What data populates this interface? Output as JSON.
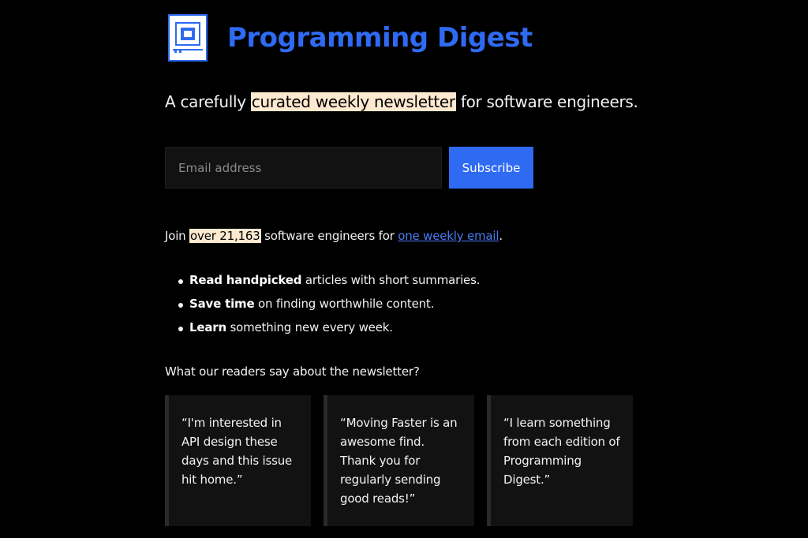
{
  "brand": {
    "title": "Programming Digest",
    "logo_icon": "computer-screen-logo-icon",
    "accent_color": "#2f6af3"
  },
  "tagline": {
    "before": "A carefully ",
    "highlight": "curated weekly newsletter",
    "after": " for software engineers."
  },
  "subscribe_form": {
    "email_placeholder": "Email address",
    "email_value": "",
    "button_label": "Subscribe"
  },
  "join": {
    "before": "Join ",
    "highlight": "over 21,163",
    "middle": " software engineers for ",
    "link_text": "one weekly email",
    "after": "."
  },
  "benefits": [
    {
      "bold": "Read handpicked",
      "rest": " articles with short summaries."
    },
    {
      "bold": "Save time",
      "rest": " on finding worthwhile content."
    },
    {
      "bold": "Learn",
      "rest": " something new every week."
    }
  ],
  "testimonials": {
    "heading": "What our readers say about the newsletter?",
    "items": [
      "“I'm interested in API design these days and this issue hit home.”",
      "“Moving Faster is an awesome find. Thank you for regularly sending good reads!”",
      "“I learn something from each edition of Programming Digest.”"
    ]
  },
  "colors": {
    "background": "#000000",
    "highlight_bg": "#fde9cf",
    "card_bg": "#121212",
    "link": "#4a7cf5"
  }
}
